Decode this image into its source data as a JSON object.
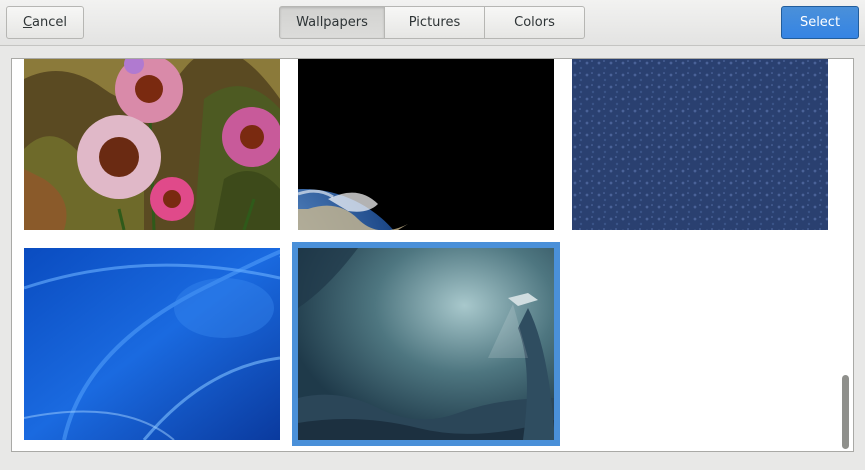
{
  "header": {
    "cancel_label": "Cancel",
    "cancel_mnemonic": "C",
    "cancel_rest": "ancel",
    "select_label": "Select",
    "tabs": [
      {
        "label": "Wallpapers",
        "active": true
      },
      {
        "label": "Pictures",
        "active": false
      },
      {
        "label": "Colors",
        "active": false
      }
    ]
  },
  "wallpapers": [
    {
      "name": "flowers",
      "selected": false
    },
    {
      "name": "earth",
      "selected": false
    },
    {
      "name": "blue-texture",
      "selected": false
    },
    {
      "name": "blue-waves",
      "selected": false
    },
    {
      "name": "underwater-cave",
      "selected": true
    }
  ],
  "colors": {
    "accent": "#4a90d9",
    "select_button": "#3584e4",
    "header_bg": "#e8e8e7"
  }
}
